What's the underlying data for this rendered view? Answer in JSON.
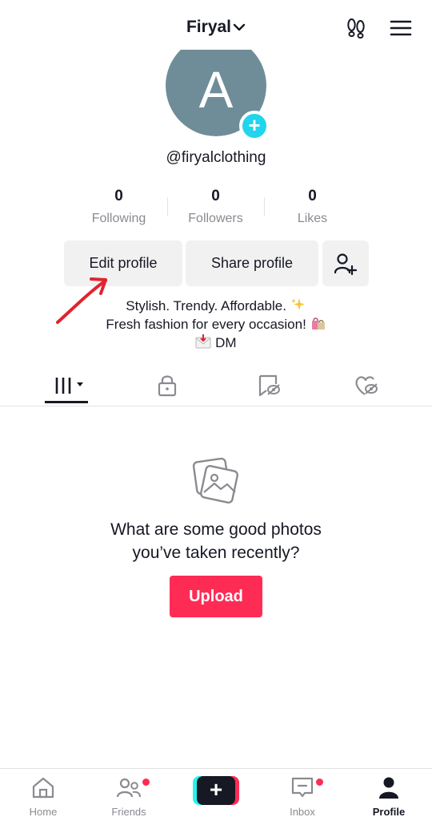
{
  "header": {
    "username": "Firyal",
    "icons": [
      "chevron-down-icon",
      "footprint-icon",
      "menu-icon"
    ]
  },
  "profile": {
    "avatar_letter": "A",
    "avatar_color": "#6f8d98",
    "handle": "@firyalclothing"
  },
  "stats": [
    {
      "value": "0",
      "label": "Following"
    },
    {
      "value": "0",
      "label": "Followers"
    },
    {
      "value": "0",
      "label": "Likes"
    }
  ],
  "actions": {
    "edit_profile": "Edit profile",
    "share_profile": "Share profile",
    "add_friend_icon": "add-person-icon"
  },
  "bio": {
    "line1": "Stylish. Trendy. Affordable.",
    "line2": "Fresh fashion for every occasion!",
    "line3": "DM"
  },
  "tabs": [
    "grid-icon",
    "lock-icon",
    "saved-icon",
    "liked-icon"
  ],
  "empty_state": {
    "prompt_line1": "What are some good photos",
    "prompt_line2": "you’ve taken recently?",
    "upload_label": "Upload"
  },
  "bottom_nav": {
    "home": "Home",
    "friends": "Friends",
    "inbox": "Inbox",
    "profile": "Profile",
    "create": "+"
  },
  "colors": {
    "accent": "#fe2c55",
    "cyan": "#25f4ee",
    "badge": "#20d5ec",
    "annotation_arrow": "#e0242e"
  }
}
